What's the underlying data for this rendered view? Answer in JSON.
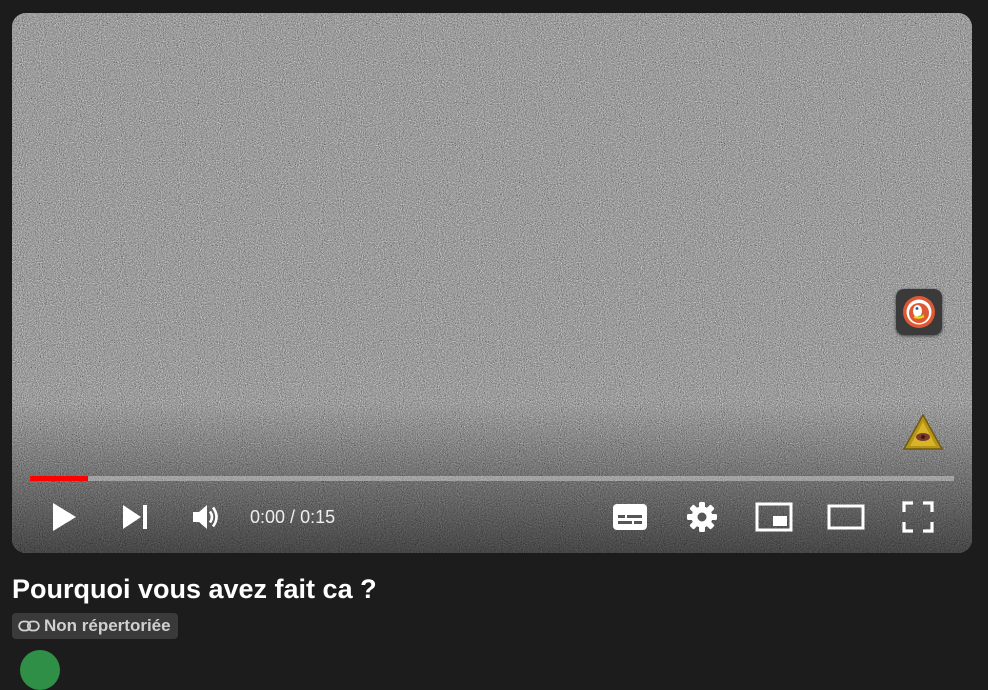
{
  "player": {
    "current_time": "0:00",
    "separator": " / ",
    "duration": "0:15",
    "progress_fraction": 0.063,
    "accent_color": "#ff0000",
    "icons": {
      "play": "play-icon",
      "next": "next-icon",
      "volume": "volume-icon",
      "subtitles": "subtitles-icon",
      "settings": "settings-gear-icon",
      "miniplayer": "miniplayer-icon",
      "theater": "theater-mode-icon",
      "fullscreen": "fullscreen-icon",
      "extension": "duckduckgo-extension-icon",
      "warning": "warning-triangle-icon"
    }
  },
  "video": {
    "title": "Pourquoi vous avez fait ca ?",
    "visibility": "Non répertoriée"
  }
}
